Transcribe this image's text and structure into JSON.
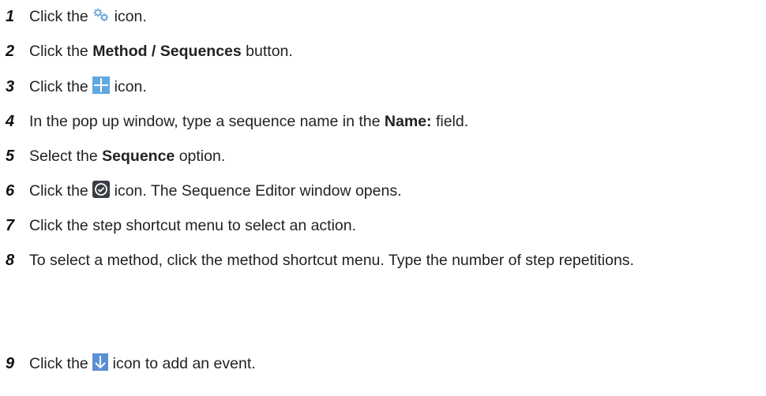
{
  "steps": [
    {
      "num": "1",
      "pre": "Click the",
      "icon": "settings-gears-icon",
      "post": "icon."
    },
    {
      "num": "2",
      "pre": "Click the",
      "bold": "Method / Sequences",
      "post": "button."
    },
    {
      "num": "3",
      "pre": "Click the",
      "icon": "add-plus-icon",
      "post": "icon."
    },
    {
      "num": "4",
      "pre": "In the pop up window, type a sequence name in the",
      "bold": "Name:",
      "post": "field."
    },
    {
      "num": "5",
      "pre": "Select the",
      "bold": "Sequence",
      "post": "option."
    },
    {
      "num": "6",
      "pre": "Click the",
      "icon": "confirm-check-icon",
      "post": "icon. The Sequence Editor window opens."
    },
    {
      "num": "7",
      "pre": "Click the step shortcut menu to select an action."
    },
    {
      "num": "8",
      "pre": "To select a method, click the method shortcut menu. Type the number of step repetitions."
    },
    {
      "num": "9",
      "pre": "Click the",
      "icon": "add-event-arrow-icon",
      "post": "icon to add an event."
    }
  ],
  "colors": {
    "gear_icon": "#5b9bd5",
    "plus_icon_bg": "#5fa8e0",
    "check_icon_bg": "#3a3d44",
    "arrow_icon_bg": "#5b8fd1"
  }
}
